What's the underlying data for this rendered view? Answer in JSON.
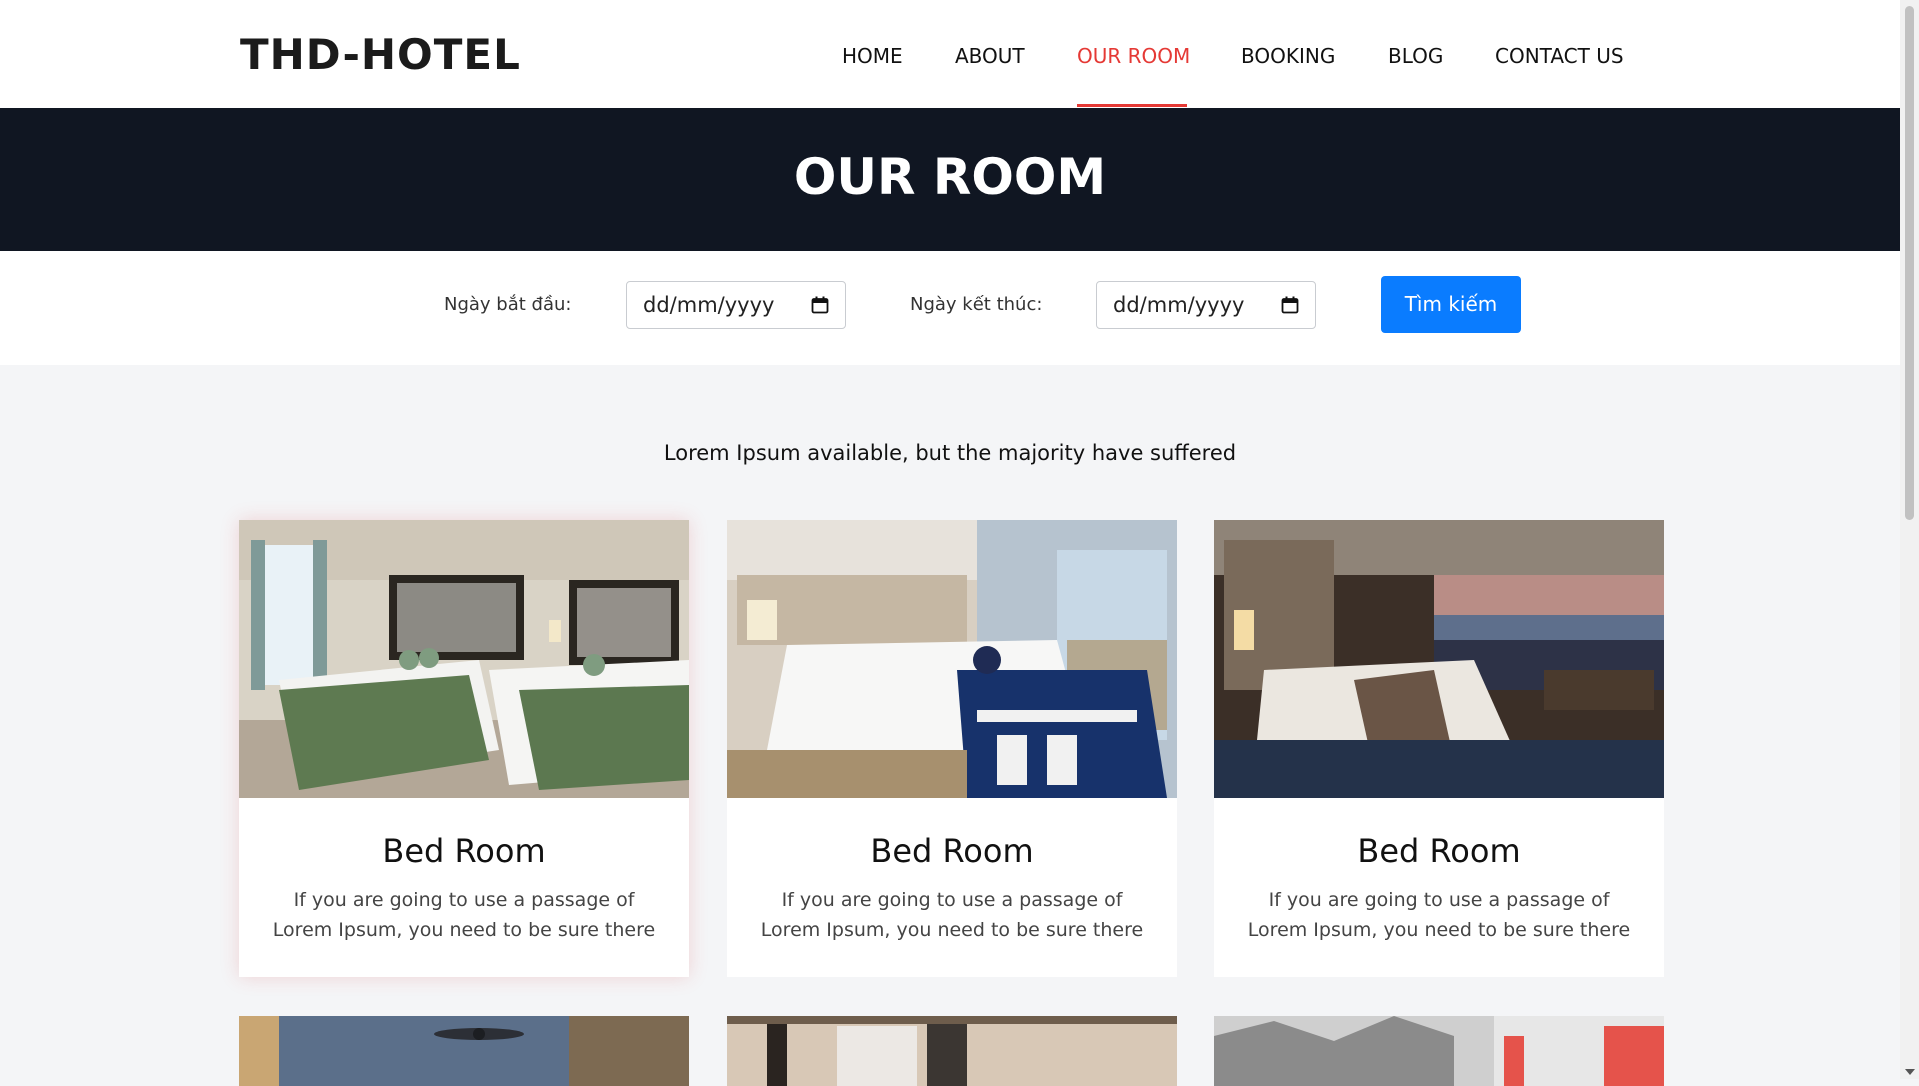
{
  "brand": {
    "logo": "THD-HOTEL"
  },
  "nav": {
    "items": [
      "HOME",
      "ABOUT",
      "OUR ROOM",
      "BOOKING",
      "BLOG",
      "CONTACT US"
    ],
    "active": "OUR ROOM"
  },
  "banner": {
    "title": "OUR ROOM"
  },
  "search": {
    "start_label": "Ngày bắt đầu:",
    "start_placeholder": "dd/mm/yyyy",
    "end_label": "Ngày kết thúc:",
    "end_placeholder": "dd/mm/yyyy",
    "button_label": "Tìm kiếm"
  },
  "content": {
    "subtitle": "Lorem Ipsum available, but the majority have suffered"
  },
  "rooms": [
    {
      "title": "Bed Room",
      "desc_line1": "If you are going to use a passage of",
      "desc_line2": "Lorem Ipsum, you need to be sure there"
    },
    {
      "title": "Bed Room",
      "desc_line1": "If you are going to use a passage of",
      "desc_line2": "Lorem Ipsum, you need to be sure there"
    },
    {
      "title": "Bed Room",
      "desc_line1": "If you are going to use a passage of",
      "desc_line2": "Lorem Ipsum, you need to be sure there"
    }
  ],
  "colors": {
    "accent": "#e53935",
    "banner": "#101622",
    "button": "#0a7cff",
    "page_bg": "#f4f5f7"
  },
  "icons": [
    "calendar-icon",
    "scroll-down-arrow-icon"
  ]
}
